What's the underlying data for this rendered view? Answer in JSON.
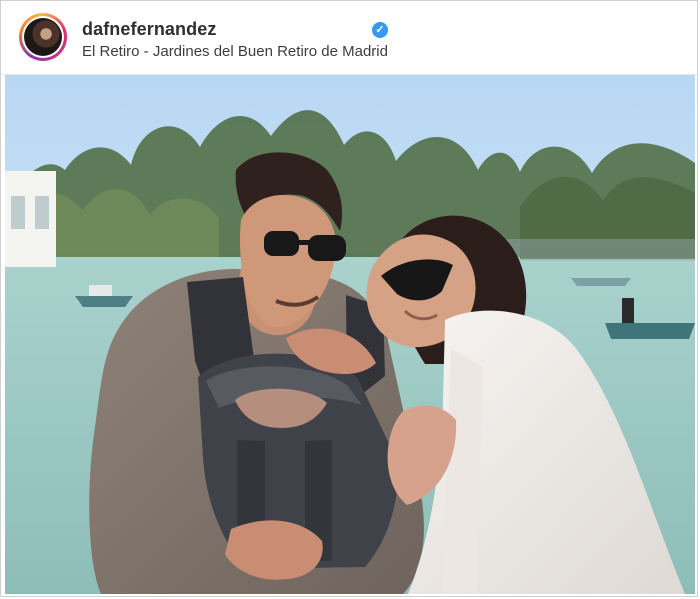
{
  "post": {
    "username": "dafnefernandez",
    "location": "El Retiro - Jardines del Buen Retiro de Madrid",
    "verified_icon": "verified-badge-icon",
    "colors": {
      "accent": "#3897f0",
      "text": "#2f2f2f",
      "sky": "#c7dff4",
      "water": "#9bc9c3"
    }
  }
}
